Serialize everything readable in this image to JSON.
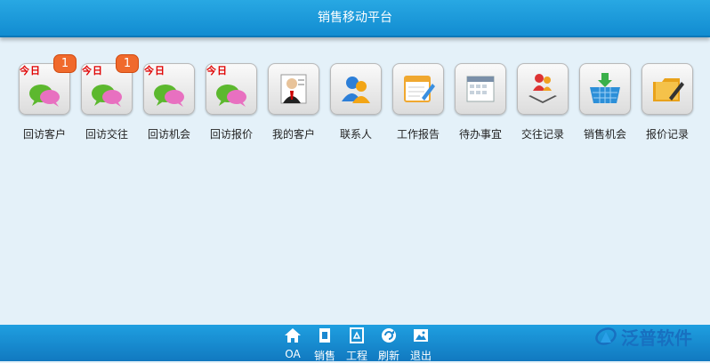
{
  "header": {
    "title": "销售移动平台"
  },
  "badge_text": "今日",
  "apps": [
    {
      "label": "回访客户",
      "badge": "1",
      "icon": "chat-bubbles-icon",
      "today": true
    },
    {
      "label": "回访交往",
      "badge": "1",
      "icon": "chat-bubbles-icon",
      "today": true
    },
    {
      "label": "回访机会",
      "badge": "",
      "icon": "chat-bubbles-icon",
      "today": true
    },
    {
      "label": "回访报价",
      "badge": "",
      "icon": "chat-bubbles-icon",
      "today": true
    },
    {
      "label": "我的客户",
      "badge": "",
      "icon": "customer-card-icon",
      "today": false
    },
    {
      "label": "联系人",
      "badge": "",
      "icon": "contacts-icon",
      "today": false
    },
    {
      "label": "工作报告",
      "badge": "",
      "icon": "report-pencil-icon",
      "today": false
    },
    {
      "label": "待办事宜",
      "badge": "",
      "icon": "calendar-icon",
      "today": false
    },
    {
      "label": "交往记录",
      "badge": "",
      "icon": "people-book-icon",
      "today": false
    },
    {
      "label": "销售机会",
      "badge": "",
      "icon": "shopping-basket-icon",
      "today": false
    },
    {
      "label": "报价记录",
      "badge": "",
      "icon": "folder-pen-icon",
      "today": false
    }
  ],
  "footer": {
    "items": [
      {
        "label": "OA",
        "icon": "home-icon"
      },
      {
        "label": "销售",
        "icon": "document-icon"
      },
      {
        "label": "工程",
        "icon": "recycle-icon"
      },
      {
        "label": "刷新",
        "icon": "refresh-icon"
      },
      {
        "label": "退出",
        "icon": "picture-icon"
      }
    ]
  },
  "brand": {
    "name": "泛普软件",
    "logo": "fanpu-logo-icon"
  },
  "colors": {
    "header": "#1a9ad9",
    "background": "#e4f1f9",
    "badge": "#f06a2c",
    "today_text": "#e00000",
    "brand": "#1870c0"
  }
}
